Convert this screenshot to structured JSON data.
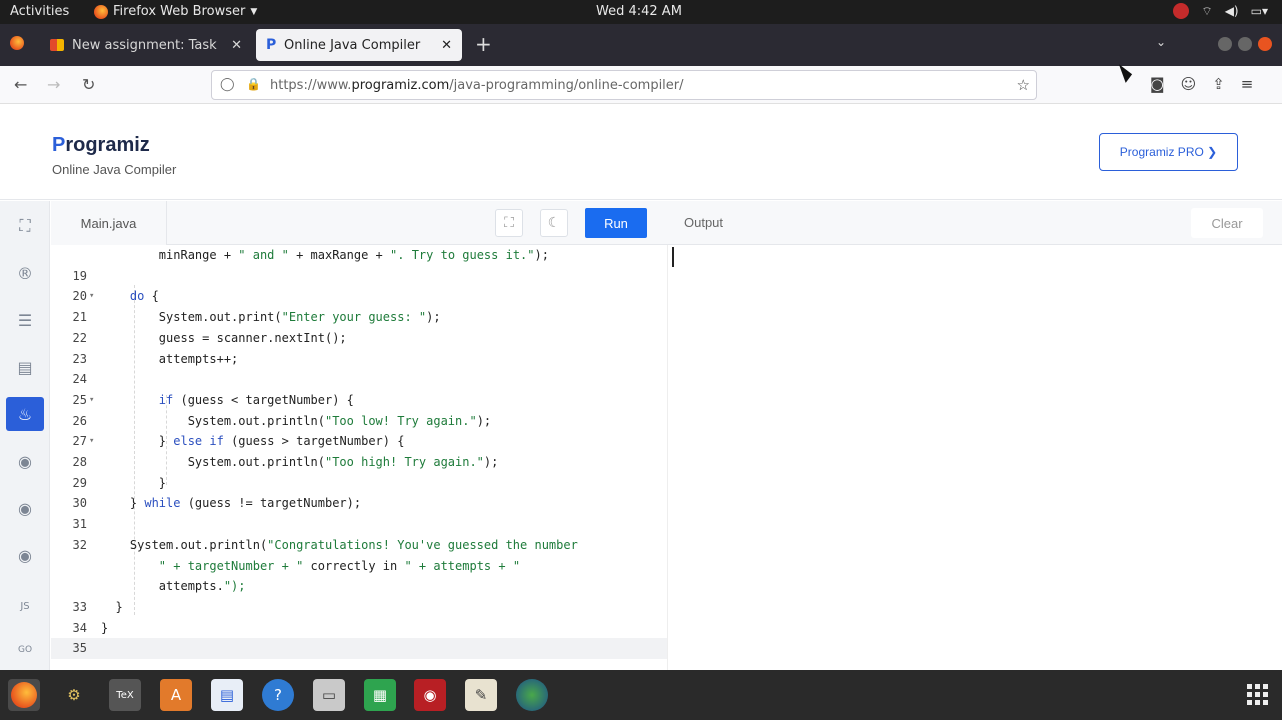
{
  "system": {
    "activities": "Activities",
    "app_name": "Firefox Web Browser",
    "clock": "Wed  4:42 AM"
  },
  "browser": {
    "tabs": [
      {
        "title": "New assignment: Task"
      },
      {
        "title": "Online Java Compiler"
      }
    ],
    "url_prefix": "https://www.",
    "url_host": "programiz.com",
    "url_path": "/java-programming/online-compiler/"
  },
  "site": {
    "logo_text": "rogramiz",
    "logo_letter": "P",
    "subtitle": "Online Java Compiler",
    "pro_button": "Programiz PRO ❯"
  },
  "editor": {
    "file_name": "Main.java",
    "run_label": "Run",
    "output_label": "Output",
    "clear_label": "Clear",
    "lines": [
      {
        "n": "",
        "fold": false,
        "text": "        minRange + \" and \" + maxRange + \". Try to guess it.\");"
      },
      {
        "n": "19",
        "fold": false,
        "text": ""
      },
      {
        "n": "20",
        "fold": true,
        "text": "    do {"
      },
      {
        "n": "21",
        "fold": false,
        "text": "        System.out.print(\"Enter your guess: \");"
      },
      {
        "n": "22",
        "fold": false,
        "text": "        guess = scanner.nextInt();"
      },
      {
        "n": "23",
        "fold": false,
        "text": "        attempts++;"
      },
      {
        "n": "24",
        "fold": false,
        "text": ""
      },
      {
        "n": "25",
        "fold": true,
        "text": "        if (guess < targetNumber) {"
      },
      {
        "n": "26",
        "fold": false,
        "text": "            System.out.println(\"Too low! Try again.\");"
      },
      {
        "n": "27",
        "fold": true,
        "text": "        } else if (guess > targetNumber) {"
      },
      {
        "n": "28",
        "fold": false,
        "text": "            System.out.println(\"Too high! Try again.\");"
      },
      {
        "n": "29",
        "fold": false,
        "text": "        }"
      },
      {
        "n": "30",
        "fold": false,
        "text": "    } while (guess != targetNumber);"
      },
      {
        "n": "31",
        "fold": false,
        "text": ""
      },
      {
        "n": "32",
        "fold": false,
        "text": "    System.out.println(\"Congratulations! You've guessed the number"
      },
      {
        "n": "",
        "fold": false,
        "text": "        \" + targetNumber + \" correctly in \" + attempts + \""
      },
      {
        "n": "",
        "fold": false,
        "text": "        attempts.\");"
      },
      {
        "n": "33",
        "fold": false,
        "text": "  }"
      },
      {
        "n": "34",
        "fold": false,
        "text": "}"
      },
      {
        "n": "35",
        "fold": false,
        "text": ""
      }
    ]
  },
  "sidebar": {
    "langs": [
      "python",
      "r",
      "sql",
      "html",
      "java",
      "c",
      "cpp",
      "csharp",
      "js",
      "go"
    ],
    "js_label": "JS",
    "go_label": "GO"
  },
  "colors": {
    "accent": "#1a6cf0",
    "brand": "#2b5fd9"
  }
}
